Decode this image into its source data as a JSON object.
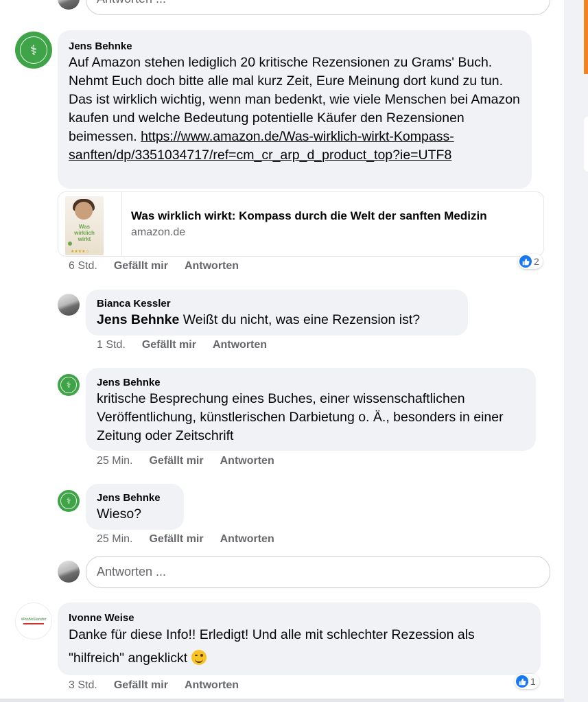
{
  "top_reply": {
    "placeholder": "Antworten ..."
  },
  "comments": [
    {
      "author": "Jens Behnke",
      "text": "Auf Amazon stehen lediglich 20 kritische Rezensionen zu Grams' Buch. Nehmt Euch doch bitte alle mal kurz Zeit, Eure Meinung dort kund zu tun. Das ist wirklich wichtig, wenn man bedenkt, wie viele Menschen bei Amazon kaufen und welche Bedeutung potentielle Käufer den Rezensionen beimessen.",
      "link": "https://www.amazon.de/Was-wirklich-wirkt-Kompass-sanften/dp/3351034717/ref=cm_cr_arp_d_product_top?ie=UTF8",
      "card": {
        "title": "Was wirklich wirkt: Kompass durch die Welt der sanften Medizin",
        "domain": "amazon.de"
      },
      "time": "6 Std.",
      "like": "Gefällt mir",
      "reply": "Antworten",
      "reactions": "2"
    },
    {
      "author": "Bianca Kessler",
      "mention": "Jens Behnke",
      "text": "Weißt du nicht, was eine Rezension ist?",
      "time": "1 Std.",
      "like": "Gefällt mir",
      "reply": "Antworten"
    },
    {
      "author": "Jens Behnke",
      "text": "kritische Besprechung eines Buches, einer wissenschaftlichen Veröffentlichung, künstlerischen Darbietung o. Ä., besonders in einer Zeitung oder Zeitschrift",
      "time": "25 Min.",
      "like": "Gefällt mir",
      "reply": "Antworten"
    },
    {
      "author": "Jens Behnke",
      "text": "Wieso?",
      "time": "25 Min.",
      "like": "Gefällt mir",
      "reply": "Antworten"
    },
    {
      "author": "Ivonne Weise",
      "text": "Danke für diese Info!! Erledigt! Und alle mit schlechter Rezession als \"hilfreich\" angeklickt",
      "time": "3 Std.",
      "like": "Gefällt mir",
      "reply": "Antworten",
      "reactions": "1"
    }
  ],
  "reply_box": {
    "placeholder": "Antworten ..."
  },
  "ivonne_avatar_text": "#ProBioStandort",
  "icons": {
    "like": "thumbs-up-icon",
    "emoji": "winking-face-emoji",
    "avatar_logo": "caduceus-logo-icon"
  },
  "colors": {
    "bubble": "#f0f2f5",
    "accent": "#f58220",
    "like_blue": "#1877f2",
    "green_avatar": "#3fa447"
  }
}
